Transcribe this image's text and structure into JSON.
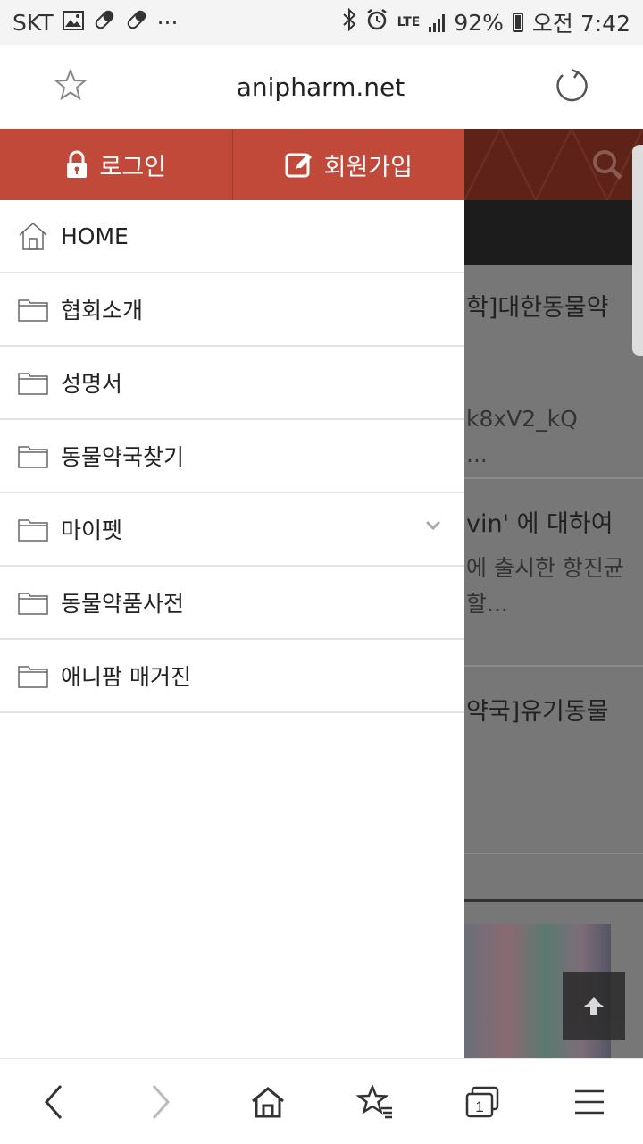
{
  "statusbar": {
    "carrier": "SKT",
    "more": "···",
    "network": "LTE",
    "battery": "92%",
    "time": "오전 7:42"
  },
  "address_bar": {
    "url": "anipharm.net"
  },
  "drawer": {
    "login_label": "로그인",
    "signup_label": "회원가입",
    "menu": [
      {
        "label": "HOME",
        "icon": "home-icon"
      },
      {
        "label": "협회소개",
        "icon": "folder-icon"
      },
      {
        "label": "성명서",
        "icon": "folder-icon"
      },
      {
        "label": "동물약국찾기",
        "icon": "folder-icon"
      },
      {
        "label": "마이펫",
        "icon": "folder-icon",
        "expandable": true
      },
      {
        "label": "동물약품사전",
        "icon": "folder-icon"
      },
      {
        "label": "애니팜 매거진",
        "icon": "folder-icon"
      }
    ]
  },
  "background_page": {
    "snippets": [
      "학]대한동물약",
      "k8xV2_kQ",
      "...",
      "vin' 에 대하여",
      "에 출시한 항진균",
      "할...",
      "약국]유기동물"
    ]
  },
  "colors": {
    "drawer_header": "#c0493a",
    "page_header": "#5e2218",
    "dim_overlay": "#777777"
  }
}
